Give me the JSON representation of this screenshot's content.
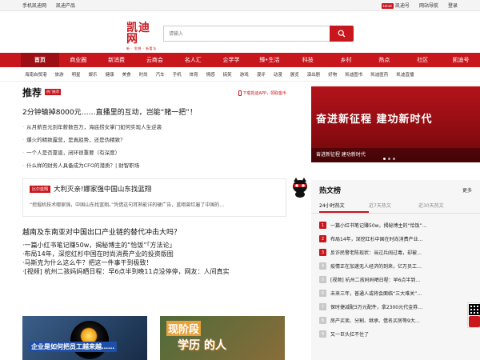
{
  "topbar": {
    "left": [
      "手机凯迪网",
      "凯迪产品"
    ],
    "right": {
      "app_badge": "kdnet",
      "app_label": "凯迪号",
      "nav": "网站导航",
      "login": "登录"
    }
  },
  "header": {
    "logo_text": "凯迪网",
    "logo_sub": "新 · 思想 · 新看法",
    "search_placeholder": "请输入",
    "search_icon": "search-icon"
  },
  "mainnav": [
    "首页",
    "商业圈",
    "新消费",
    "云商会",
    "名人汇",
    "企学学",
    "臻•生活",
    "科技",
    "乡村",
    "热点",
    "社区",
    "凯迪号"
  ],
  "subnav": [
    "海南自贸港",
    "旅游",
    "明星",
    "娱乐",
    "健康",
    "美食",
    "时尚",
    "汽车",
    "手机",
    "体育",
    "情感",
    "搞笑",
    "游戏",
    "漫评",
    "动漫",
    "展览",
    "演出剧",
    "好物",
    "凯迪图书",
    "凯迪医药",
    "凯迪直播"
  ],
  "recommend": {
    "title": "推荐",
    "tag": "热门推荐",
    "app_link": "下载凯迪APP，领取金币",
    "headline": "2分钟输掉8000元……直播里的互动，岂能“赌一把”！",
    "items": [
      "从月薪百元到年薪数百万，海底捞女掌门如何实现人生逆袭",
      "爆火的精致露营，是真趋势，还是伪精致？",
      "一个人是否靠谱，闭环很重要（有深度）",
      "什么样的财务人具备成为CFO的潜质？| 财智职场"
    ],
    "card": {
      "tag": "比尔蓝翔",
      "title": "大利灭亲!娜家强中国山东找蓝翔",
      "summary": "“挖掘机技术哪家强，中国山东找蓝翔。”凭借这句耳熟能详的硬广告，蓝翔曾红遍了中国的…"
    },
    "headline2": "越南及东南亚对中国出口产业链的替代冲击大吗？",
    "items2": [
      "一篇小红书笔记赚50w，揭秘博主的“恰饭”「方法论」",
      "布局14年，深挖红杉中国在时尚消费产业的投资版图",
      "马斯克为什么这么牛？把这一件事干到极致！",
      "[视频] 杭州二孩妈妈晒日程：早6点半到晚11点没停停，网友：人间真实"
    ],
    "thumb1_text": "企业是如何把员工越来越……",
    "thumb2_t1": "现阶段",
    "thumb2_t2": "学历 的人"
  },
  "banner": {
    "slogan": "奋进新征程 建功新时代",
    "caption": "奋进新征程 建功新时代"
  },
  "hot": {
    "title": "热文榜",
    "more": "更多",
    "tabs": [
      "24小时热文",
      "近7天热文",
      "近30天热文"
    ],
    "items": [
      "一篇小红书笔记赚50w，揭秘博主的“恰饭”…",
      "布局14年，深挖红杉中国在时尚消费产业…",
      "反诈民警老陈现状：当过兵阔过毒，却被…",
      "疫情正在加速无人经济的到来，亿万员工…",
      "[视频] 杭州二孩妈妈晒日程：早6点半到…",
      "未来三年，普通人或将会面临“三大难关”…",
      "保时捷减配3万元配件，拿2300元代金券…",
      "房产买卖、分割、继承、借名买房等9大…",
      "又一巨头扛不住了"
    ]
  }
}
